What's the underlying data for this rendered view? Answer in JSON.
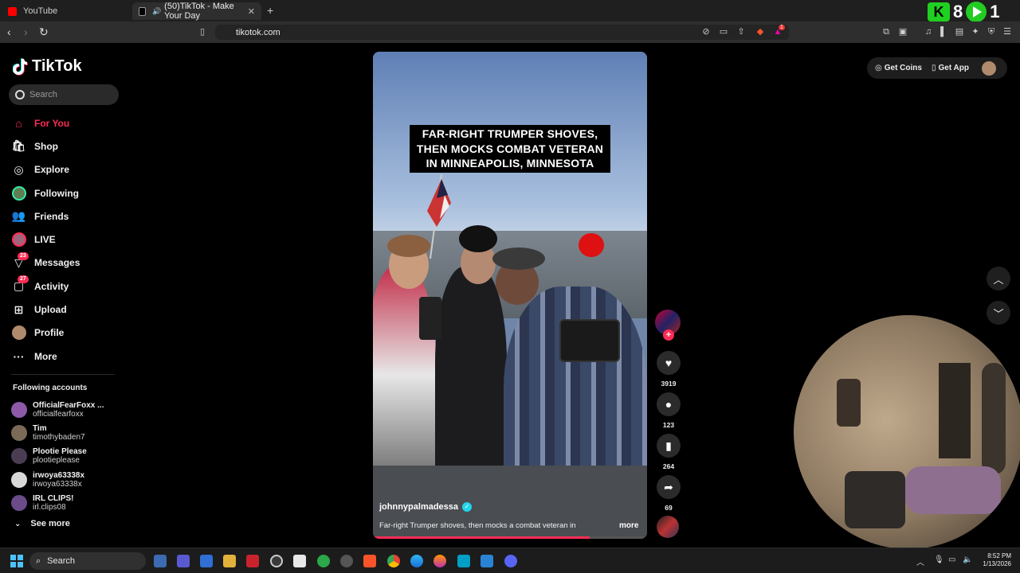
{
  "browser": {
    "tabs": [
      {
        "label": "YouTube",
        "active": false,
        "color": "#ff0000"
      },
      {
        "label": "(50)TikTok - Make Your Day",
        "active": true,
        "color": "#ffffff"
      }
    ],
    "url": "tikotok.com",
    "extension_badge": "1"
  },
  "overlay": {
    "k_label": "K",
    "k_count": "8",
    "play_count": "1"
  },
  "sidebar": {
    "brand": "TikTok",
    "search_placeholder": "Search",
    "nav": [
      {
        "label": "For You",
        "icon": "home-icon",
        "active": true
      },
      {
        "label": "Shop",
        "icon": "shop-icon"
      },
      {
        "label": "Explore",
        "icon": "compass-icon"
      },
      {
        "label": "Following",
        "icon": "following-avatar"
      },
      {
        "label": "Friends",
        "icon": "friends-icon"
      },
      {
        "label": "LIVE",
        "icon": "live-avatar"
      },
      {
        "label": "Messages",
        "icon": "messages-icon",
        "badge": "23"
      },
      {
        "label": "Activity",
        "icon": "activity-icon",
        "badge": "27"
      },
      {
        "label": "Upload",
        "icon": "upload-icon"
      },
      {
        "label": "Profile",
        "icon": "profile-avatar"
      },
      {
        "label": "More",
        "icon": "more-icon"
      }
    ],
    "following_heading": "Following accounts",
    "following": [
      {
        "name": "OfficialFearFoxx ...",
        "handle": "officialfearfoxx",
        "color": "#8e5aa8"
      },
      {
        "name": "Tim",
        "handle": "timothybaden7",
        "color": "#7c6a58"
      },
      {
        "name": "Plootie Please",
        "handle": "plootieplease",
        "color": "#4a3d52"
      },
      {
        "name": "irwoya63338x",
        "handle": "irwoya63338x",
        "color": "#d8d8d8"
      },
      {
        "name": "IRL CLIPS!",
        "handle": "irl.clips08",
        "color": "#6b4b8a"
      }
    ],
    "see_more": "See more"
  },
  "video": {
    "caption": [
      "FAR-RIGHT TRUMPER SHOVES,",
      "THEN MOCKS COMBAT VETERAN",
      "IN MINNEAPOLIS, MINNESOTA"
    ],
    "author": "johnnypalmadessa",
    "description": "Far-right Trumper shoves, then mocks a combat veteran in",
    "more": "more",
    "progress": 0.79
  },
  "actions": {
    "likes": "3919",
    "comments": "123",
    "saves": "264",
    "shares": "69"
  },
  "header_actions": {
    "coins": "Get Coins",
    "app": "Get App"
  },
  "taskbar": {
    "search_label": "Search",
    "time": "8:52 PM",
    "date": "1/13/2026"
  }
}
